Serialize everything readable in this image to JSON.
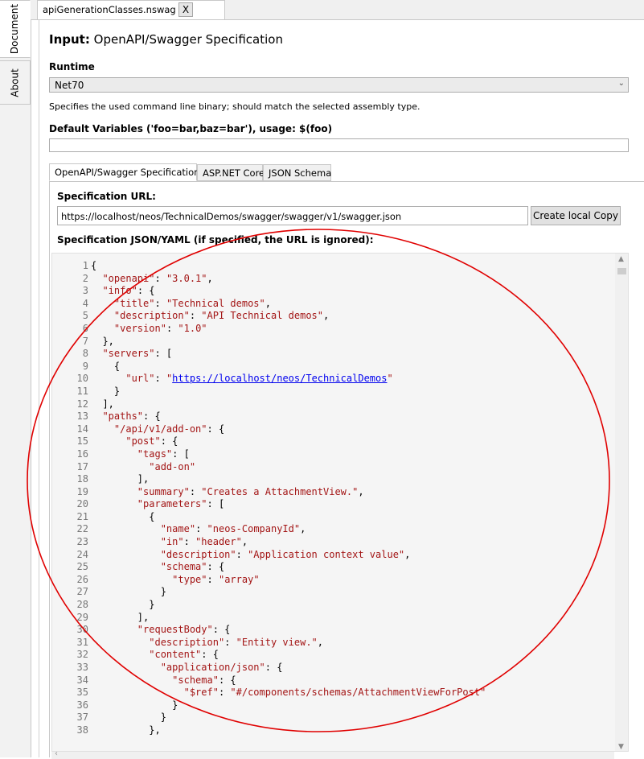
{
  "side_tabs": [
    "Document",
    "About"
  ],
  "doc_tab": {
    "title": "apiGenerationClasses.nswag",
    "close": "X"
  },
  "header": {
    "prefix": "Input:",
    "title": "OpenAPI/Swagger Specification"
  },
  "runtime": {
    "label": "Runtime",
    "value": "Net70",
    "hint": "Specifies the used command line binary; should match the selected assembly type."
  },
  "default_vars": {
    "label": "Default Variables ('foo=bar,baz=bar'), usage: $(foo)",
    "value": ""
  },
  "tabs": [
    "OpenAPI/Swagger Specification",
    "ASP.NET Core",
    "JSON Schema"
  ],
  "spec": {
    "url_label": "Specification URL:",
    "url": "https://localhost/neos/TechnicalDemos/swagger/swagger/v1/swagger.json",
    "copy_button": "Create local Copy",
    "json_label": "Specification JSON/YAML (if specified, the URL is ignored):"
  },
  "code_lines": [
    [
      {
        "t": "p",
        "v": "{"
      }
    ],
    [
      {
        "t": "p",
        "v": "  "
      },
      {
        "t": "k",
        "v": "\"openapi\""
      },
      {
        "t": "p",
        "v": ": "
      },
      {
        "t": "s",
        "v": "\"3.0.1\""
      },
      {
        "t": "p",
        "v": ","
      }
    ],
    [
      {
        "t": "p",
        "v": "  "
      },
      {
        "t": "k",
        "v": "\"info\""
      },
      {
        "t": "p",
        "v": ": {"
      }
    ],
    [
      {
        "t": "p",
        "v": "    "
      },
      {
        "t": "k",
        "v": "\"title\""
      },
      {
        "t": "p",
        "v": ": "
      },
      {
        "t": "s",
        "v": "\"Technical demos\""
      },
      {
        "t": "p",
        "v": ","
      }
    ],
    [
      {
        "t": "p",
        "v": "    "
      },
      {
        "t": "k",
        "v": "\"description\""
      },
      {
        "t": "p",
        "v": ": "
      },
      {
        "t": "s",
        "v": "\"API Technical demos\""
      },
      {
        "t": "p",
        "v": ","
      }
    ],
    [
      {
        "t": "p",
        "v": "    "
      },
      {
        "t": "k",
        "v": "\"version\""
      },
      {
        "t": "p",
        "v": ": "
      },
      {
        "t": "s",
        "v": "\"1.0\""
      }
    ],
    [
      {
        "t": "p",
        "v": "  },"
      }
    ],
    [
      {
        "t": "p",
        "v": "  "
      },
      {
        "t": "k",
        "v": "\"servers\""
      },
      {
        "t": "p",
        "v": ": ["
      }
    ],
    [
      {
        "t": "p",
        "v": "    {"
      }
    ],
    [
      {
        "t": "p",
        "v": "      "
      },
      {
        "t": "k",
        "v": "\"url\""
      },
      {
        "t": "p",
        "v": ": "
      },
      {
        "t": "s",
        "v": "\""
      },
      {
        "t": "u",
        "v": "https://localhost/neos/TechnicalDemos"
      },
      {
        "t": "s",
        "v": "\""
      }
    ],
    [
      {
        "t": "p",
        "v": "    }"
      }
    ],
    [
      {
        "t": "p",
        "v": "  ],"
      }
    ],
    [
      {
        "t": "p",
        "v": "  "
      },
      {
        "t": "k",
        "v": "\"paths\""
      },
      {
        "t": "p",
        "v": ": {"
      }
    ],
    [
      {
        "t": "p",
        "v": "    "
      },
      {
        "t": "k",
        "v": "\"/api/v1/add-on\""
      },
      {
        "t": "p",
        "v": ": {"
      }
    ],
    [
      {
        "t": "p",
        "v": "      "
      },
      {
        "t": "k",
        "v": "\"post\""
      },
      {
        "t": "p",
        "v": ": {"
      }
    ],
    [
      {
        "t": "p",
        "v": "        "
      },
      {
        "t": "k",
        "v": "\"tags\""
      },
      {
        "t": "p",
        "v": ": ["
      }
    ],
    [
      {
        "t": "p",
        "v": "          "
      },
      {
        "t": "s",
        "v": "\"add-on\""
      }
    ],
    [
      {
        "t": "p",
        "v": "        ],"
      }
    ],
    [
      {
        "t": "p",
        "v": "        "
      },
      {
        "t": "k",
        "v": "\"summary\""
      },
      {
        "t": "p",
        "v": ": "
      },
      {
        "t": "s",
        "v": "\"Creates a AttachmentView.\""
      },
      {
        "t": "p",
        "v": ","
      }
    ],
    [
      {
        "t": "p",
        "v": "        "
      },
      {
        "t": "k",
        "v": "\"parameters\""
      },
      {
        "t": "p",
        "v": ": ["
      }
    ],
    [
      {
        "t": "p",
        "v": "          {"
      }
    ],
    [
      {
        "t": "p",
        "v": "            "
      },
      {
        "t": "k",
        "v": "\"name\""
      },
      {
        "t": "p",
        "v": ": "
      },
      {
        "t": "s",
        "v": "\"neos-CompanyId\""
      },
      {
        "t": "p",
        "v": ","
      }
    ],
    [
      {
        "t": "p",
        "v": "            "
      },
      {
        "t": "k",
        "v": "\"in\""
      },
      {
        "t": "p",
        "v": ": "
      },
      {
        "t": "s",
        "v": "\"header\""
      },
      {
        "t": "p",
        "v": ","
      }
    ],
    [
      {
        "t": "p",
        "v": "            "
      },
      {
        "t": "k",
        "v": "\"description\""
      },
      {
        "t": "p",
        "v": ": "
      },
      {
        "t": "s",
        "v": "\"Application context value\""
      },
      {
        "t": "p",
        "v": ","
      }
    ],
    [
      {
        "t": "p",
        "v": "            "
      },
      {
        "t": "k",
        "v": "\"schema\""
      },
      {
        "t": "p",
        "v": ": {"
      }
    ],
    [
      {
        "t": "p",
        "v": "              "
      },
      {
        "t": "k",
        "v": "\"type\""
      },
      {
        "t": "p",
        "v": ": "
      },
      {
        "t": "s",
        "v": "\"array\""
      }
    ],
    [
      {
        "t": "p",
        "v": "            }"
      }
    ],
    [
      {
        "t": "p",
        "v": "          }"
      }
    ],
    [
      {
        "t": "p",
        "v": "        ],"
      }
    ],
    [
      {
        "t": "p",
        "v": "        "
      },
      {
        "t": "k",
        "v": "\"requestBody\""
      },
      {
        "t": "p",
        "v": ": {"
      }
    ],
    [
      {
        "t": "p",
        "v": "          "
      },
      {
        "t": "k",
        "v": "\"description\""
      },
      {
        "t": "p",
        "v": ": "
      },
      {
        "t": "s",
        "v": "\"Entity view.\""
      },
      {
        "t": "p",
        "v": ","
      }
    ],
    [
      {
        "t": "p",
        "v": "          "
      },
      {
        "t": "k",
        "v": "\"content\""
      },
      {
        "t": "p",
        "v": ": {"
      }
    ],
    [
      {
        "t": "p",
        "v": "            "
      },
      {
        "t": "k",
        "v": "\"application/json\""
      },
      {
        "t": "p",
        "v": ": {"
      }
    ],
    [
      {
        "t": "p",
        "v": "              "
      },
      {
        "t": "k",
        "v": "\"schema\""
      },
      {
        "t": "p",
        "v": ": {"
      }
    ],
    [
      {
        "t": "p",
        "v": "                "
      },
      {
        "t": "k",
        "v": "\"$ref\""
      },
      {
        "t": "p",
        "v": ": "
      },
      {
        "t": "s",
        "v": "\"#/components/schemas/AttachmentViewForPost\""
      }
    ],
    [
      {
        "t": "p",
        "v": "              }"
      }
    ],
    [
      {
        "t": "p",
        "v": "            }"
      }
    ],
    [
      {
        "t": "p",
        "v": "          },"
      }
    ]
  ],
  "annotation_color": "#e00000"
}
